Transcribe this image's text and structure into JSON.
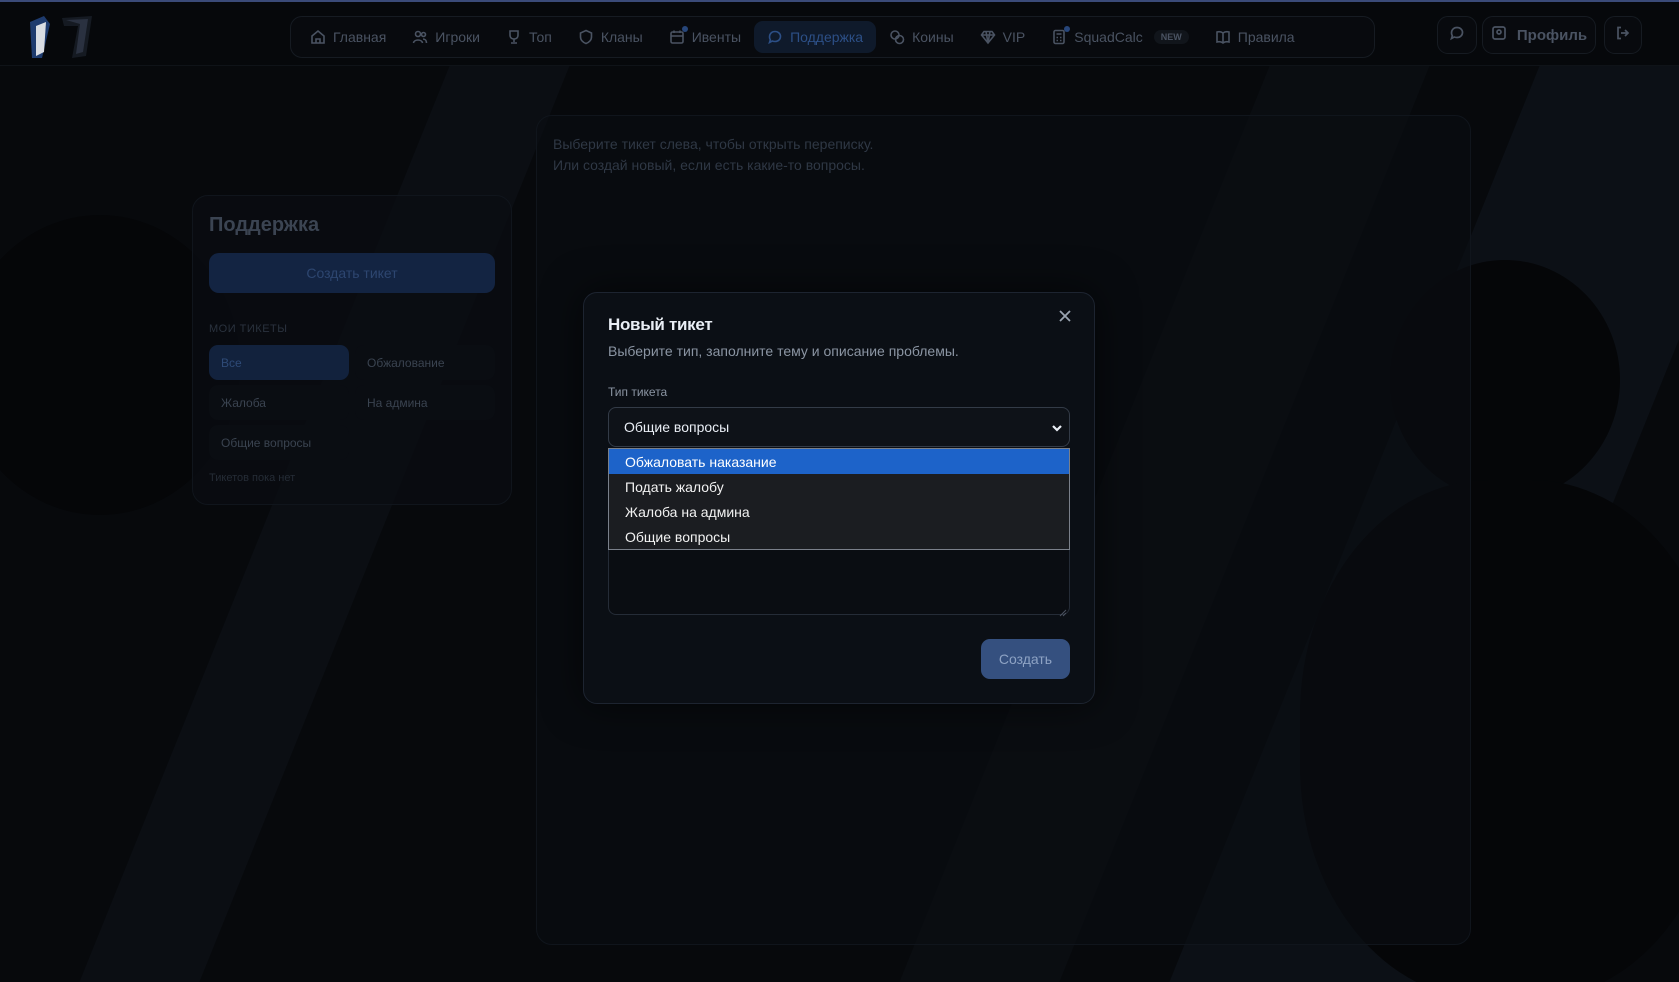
{
  "nav": {
    "items": [
      {
        "label": "Главная",
        "icon": "home-icon"
      },
      {
        "label": "Игроки",
        "icon": "users-icon"
      },
      {
        "label": "Топ",
        "icon": "trophy-icon"
      },
      {
        "label": "Кланы",
        "icon": "shield-icon"
      },
      {
        "label": "Ивенты",
        "icon": "calendar-icon"
      },
      {
        "label": "Поддержка",
        "icon": "chat-icon",
        "active": true
      },
      {
        "label": "Коины",
        "icon": "coins-icon"
      },
      {
        "label": "VIP",
        "icon": "diamond-icon"
      },
      {
        "label": "SquadCalc",
        "icon": "calculator-icon",
        "badge": "NEW"
      },
      {
        "label": "Правила",
        "icon": "book-icon"
      }
    ],
    "profile_label": "Профиль"
  },
  "chat": {
    "hint_line1": "Выберите тикет слева, чтобы открыть переписку.",
    "hint_line2": "Или создай новый, если есть какие-то вопросы."
  },
  "sidebar": {
    "title": "Поддержка",
    "create_button": "Создать тикет",
    "my_tickets_label": "МОИ ТИКЕТЫ",
    "filters": [
      "Все",
      "Обжалование",
      "Жалоба",
      "На админа",
      "Общие вопросы"
    ],
    "empty_text": "Тикетов пока нет"
  },
  "modal": {
    "title": "Новый тикет",
    "subtitle": "Выберите тип, заполните тему и описание проблемы.",
    "type_label": "Тип тикета",
    "selected_type": "Общие вопросы",
    "options": [
      "Обжаловать наказание",
      "Подать жалобу",
      "Жалоба на админа",
      "Общие вопросы"
    ],
    "highlighted_option": "Обжаловать наказание",
    "submit_label": "Создать"
  },
  "colors": {
    "accent": "#1d63c9",
    "background": "#07090c",
    "modal_bg": "#0b0f15"
  }
}
